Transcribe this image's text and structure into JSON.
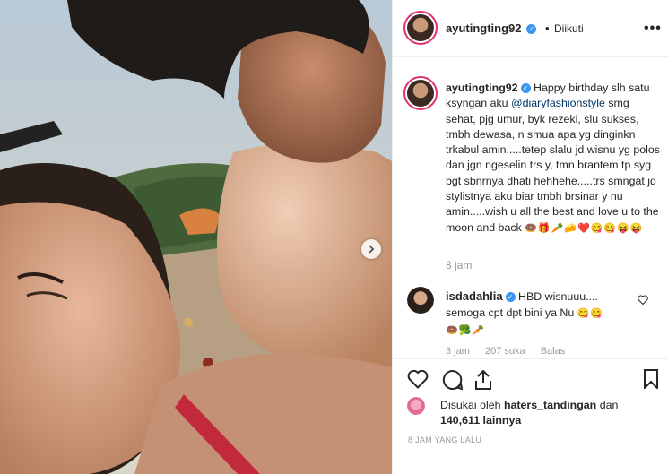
{
  "header": {
    "username": "ayutingting92",
    "separator": "•",
    "follow_label": "Diikuti",
    "more": "•••"
  },
  "caption": {
    "username": "ayutingting92",
    "text_before": "Happy birthday slh satu ksyngan aku ",
    "mention": "@diaryfashionstyle",
    "text_after": " smg sehat, pjg umur, byk rezeki, slu sukses, tmbh dewasa, n smua apa yg dinginkn trkabul amin.....tetep slalu jd wisnu yg polos dan jgn ngeselin trs y, tmn brantem tp syg bgt sbnrnya dhati hehhehe.....trs smngat jd stylistnya aku biar tmbh brsinar y nu amin.....wish u all the best and love u to the moon and back",
    "emojis": "🍩🎁🥕🧀❤️😋😋😝😝",
    "time": "8 jam"
  },
  "comment": {
    "username": "isdadahlia",
    "text": "HBD wisnuuu.... semoga cpt dpt bini ya Nu",
    "emojis_inline": "😋😋",
    "emojis_line": "🍩🥦🥕",
    "time": "3 jam",
    "likes": "207 suka",
    "reply": "Balas"
  },
  "likes": {
    "prefix": "Disukai oleh",
    "user": "haters_tandingan",
    "conj": "dan",
    "count": "140,611 lainnya"
  },
  "posted": "8 JAM YANG LALU",
  "colors": {
    "verified": "#3897f0",
    "mention": "#003569",
    "story_ring": "#e1306c"
  }
}
